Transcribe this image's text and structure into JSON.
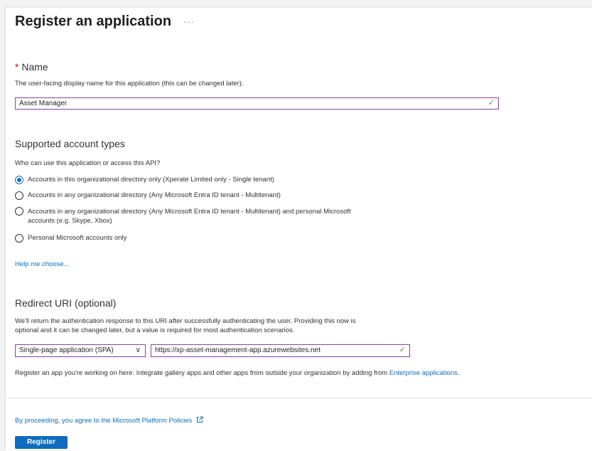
{
  "page": {
    "title": "Register an application",
    "more_icon": "···"
  },
  "name_section": {
    "required_marker": "*",
    "label": "Name",
    "description": "The user-facing display name for this application (this can be changed later).",
    "value": "Asset Manager",
    "valid_icon": "✓"
  },
  "account_types": {
    "title": "Supported account types",
    "question": "Who can use this application or access this API?",
    "options": [
      {
        "label": "Accounts in this organizational directory only (Xperate Limited only - Single tenant)",
        "selected": true
      },
      {
        "label": "Accounts in any organizational directory (Any Microsoft Entra ID tenant - Multitenant)",
        "selected": false
      },
      {
        "label": "Accounts in any organizational directory (Any Microsoft Entra ID tenant - Multitenant) and personal Microsoft",
        "label_line2": "accounts (e.g. Skype, Xbox)",
        "selected": false
      },
      {
        "label": "Personal Microsoft accounts only",
        "selected": false
      }
    ],
    "help_link": "Help me choose..."
  },
  "redirect": {
    "title": "Redirect URI (optional)",
    "description_line1": "We'll return the authentication response to this URI after successfully authenticating the user. Providing this now is",
    "description_line2": "optional and it can be changed later, but a value is required for most authentication scenarios.",
    "platform_value": "Single-page application (SPA)",
    "uri_value": "https://xp-asset-management-app.azurewebsites.net",
    "valid_icon": "✓"
  },
  "note": {
    "text": "Register an app you're working on here. Integrate gallery apps and other apps from outside your organization by adding from ",
    "link": "Enterprise applications",
    "end": "."
  },
  "footer": {
    "policy_link": "By proceeding, you agree to the Microsoft Platform Policies",
    "register_label": "Register"
  }
}
